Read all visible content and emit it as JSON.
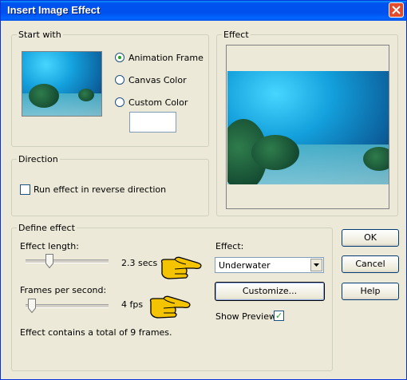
{
  "window": {
    "title": "Insert Image Effect"
  },
  "start_with": {
    "label": "Start with",
    "options": [
      {
        "label": "Animation Frame",
        "selected": true
      },
      {
        "label": "Canvas Color",
        "selected": false
      },
      {
        "label": "Custom Color",
        "selected": false
      }
    ],
    "custom_color": "#ffffff"
  },
  "effect_preview": {
    "label": "Effect"
  },
  "direction": {
    "label": "Direction",
    "reverse_label": "Run effect in reverse direction",
    "reverse_checked": false
  },
  "define_effect": {
    "label": "Define effect",
    "length_label": "Effect length:",
    "length_value": "2.3 secs",
    "length_fraction": 0.3,
    "fps_label": "Frames per second:",
    "fps_value": "4 fps",
    "fps_fraction": 0.1,
    "total_frames_text": "Effect contains a total of 9 frames.",
    "effect_label": "Effect:",
    "effect_selected": "Underwater",
    "customize_label": "Customize...",
    "show_preview_label": "Show Preview",
    "show_preview_checked": true
  },
  "buttons": {
    "ok": "OK",
    "cancel": "Cancel",
    "help": "Help"
  },
  "colors": {
    "title_bar": "#0053ee",
    "dialog_bg": "#ece9d8",
    "close": "#e34b2c",
    "pointer_hand": "#f5c400"
  }
}
